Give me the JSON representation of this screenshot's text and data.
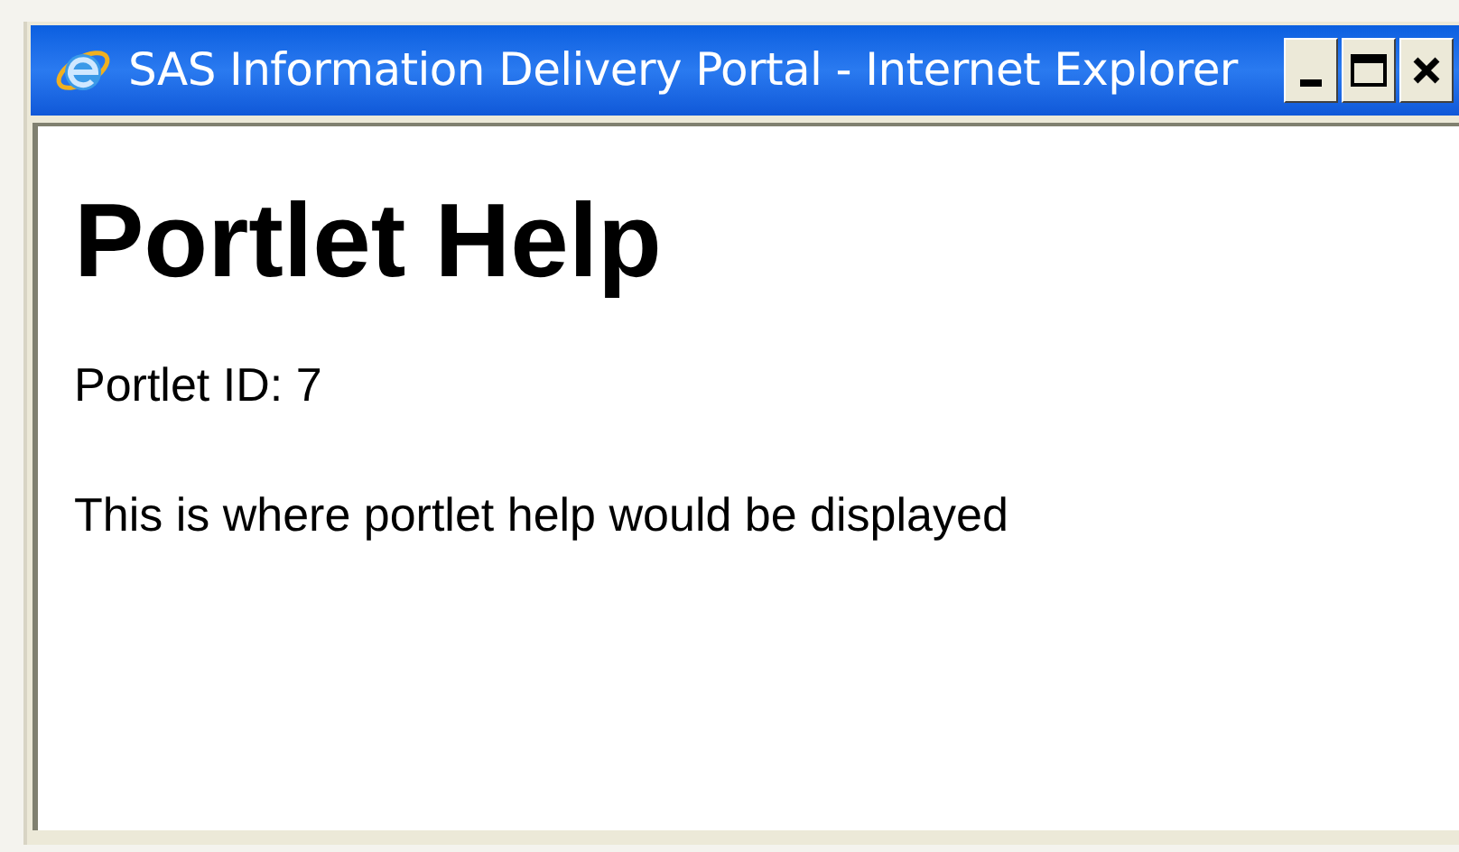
{
  "window": {
    "title": "SAS Information Delivery Portal - Internet Explorer"
  },
  "page": {
    "heading": "Portlet Help",
    "paragraphs": [
      "Portlet ID: 7",
      "This is where portlet help would be displayed"
    ]
  }
}
